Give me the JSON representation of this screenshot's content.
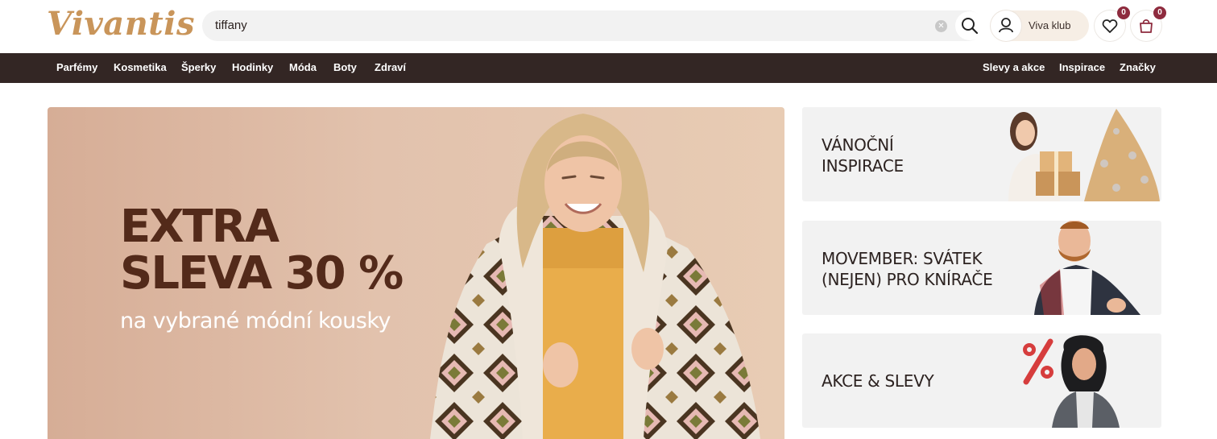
{
  "header": {
    "logo": "Vivantis",
    "search": {
      "value": "tiffany"
    },
    "user_label": "Viva klub",
    "wishlist_count": "0",
    "cart_count": "0"
  },
  "nav": {
    "left": [
      "Parfémy",
      "Kosmetika",
      "Šperky",
      "Hodinky",
      "Móda",
      "Boty",
      "Zdraví"
    ],
    "right": [
      "Slevy a akce",
      "Inspirace",
      "Značky"
    ]
  },
  "hero": {
    "title_line1": "EXTRA",
    "title_line2": "SLEVA 30 %",
    "subtitle": "na vybrané módní kousky"
  },
  "promos": [
    {
      "line1": "VÁNOČNÍ",
      "line2": "INSPIRACE"
    },
    {
      "line1": "MOVEMBER: SVÁTEK",
      "line2": "(NEJEN) PRO KNÍRAČE"
    },
    {
      "line1": "AKCE & SLEVY",
      "line2": ""
    }
  ],
  "colors": {
    "brand_gold": "#c9955a",
    "nav_bg": "#332624",
    "badge": "#8e2b3e",
    "hero_title": "#532a1a"
  },
  "icons": [
    "search-icon",
    "clear-icon",
    "user-icon",
    "heart-icon",
    "bag-icon"
  ]
}
